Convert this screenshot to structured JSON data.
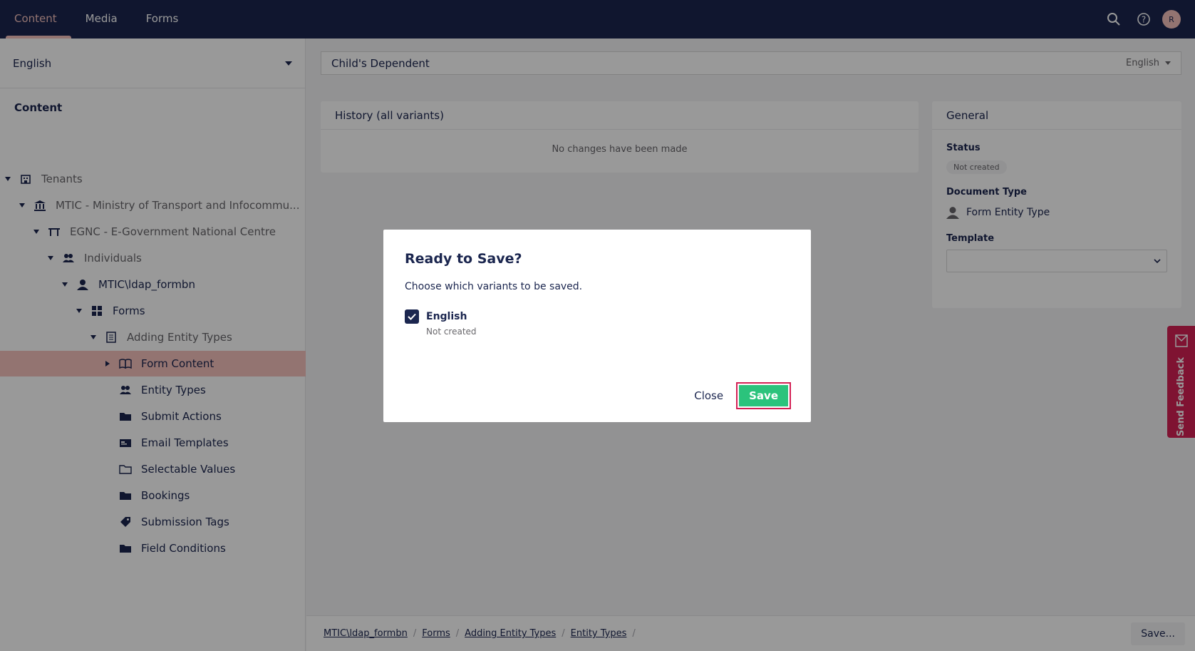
{
  "topnav": {
    "tabs": [
      {
        "label": "Content",
        "active": true
      },
      {
        "label": "Media",
        "active": false
      },
      {
        "label": "Forms",
        "active": false
      }
    ],
    "avatar_initial": "R",
    "icons": [
      "search-icon",
      "help-icon"
    ]
  },
  "sidebar": {
    "language": "English",
    "section_title": "Content",
    "tree": [
      {
        "label": "Tenants",
        "icon": "tenants-icon",
        "muted": true
      },
      {
        "label": "MTIC - Ministry of Transport and Infocommu...",
        "icon": "bank-icon",
        "muted": true
      },
      {
        "label": "EGNC - E-Government National Centre",
        "icon": "gateway-icon",
        "muted": true
      },
      {
        "label": "Individuals",
        "icon": "users-icon",
        "muted": true
      },
      {
        "label": "MTIC\\ldap_formbn",
        "icon": "user-icon",
        "muted": false
      },
      {
        "label": "Forms",
        "icon": "grid-icon",
        "muted": false
      },
      {
        "label": "Adding Entity Types",
        "icon": "document-icon",
        "muted": true
      },
      {
        "label": "Form Content",
        "icon": "book-icon",
        "muted": false,
        "selected": true
      },
      {
        "label": "Entity Types",
        "icon": "users-icon",
        "muted": false
      },
      {
        "label": "Submit Actions",
        "icon": "folder-icon",
        "muted": false
      },
      {
        "label": "Email Templates",
        "icon": "email-icon",
        "muted": false
      },
      {
        "label": "Selectable Values",
        "icon": "folder-outline-icon",
        "muted": false
      },
      {
        "label": "Bookings",
        "icon": "folder-icon",
        "muted": false
      },
      {
        "label": "Submission Tags",
        "icon": "tags-icon",
        "muted": false
      },
      {
        "label": "Field Conditions",
        "icon": "folder-icon",
        "muted": false
      }
    ]
  },
  "editor": {
    "name": "Child's Dependent",
    "variant": "English",
    "history_title": "History (all variants)",
    "history_empty": "No changes have been made",
    "general_title": "General",
    "status_label": "Status",
    "status_value": "Not created",
    "doctype_label": "Document Type",
    "doctype_value": "Form Entity Type",
    "template_label": "Template",
    "template_value": ""
  },
  "footer": {
    "breadcrumbs": [
      "MTIC\\ldap_formbn",
      "Forms",
      "Adding Entity Types",
      "Entity Types"
    ],
    "save_label": "Save..."
  },
  "feedback": {
    "label": "Send Feedback"
  },
  "modal": {
    "title": "Ready to Save?",
    "subtitle": "Choose which variants to be saved.",
    "variant_name": "English",
    "variant_state": "Not created",
    "variant_checked": true,
    "close_label": "Close",
    "save_label": "Save"
  },
  "colors": {
    "header_bg": "#1b264f",
    "accent_pink": "#f5c1bc",
    "save_green": "#2bc37c",
    "feedback_red": "#d42054"
  }
}
